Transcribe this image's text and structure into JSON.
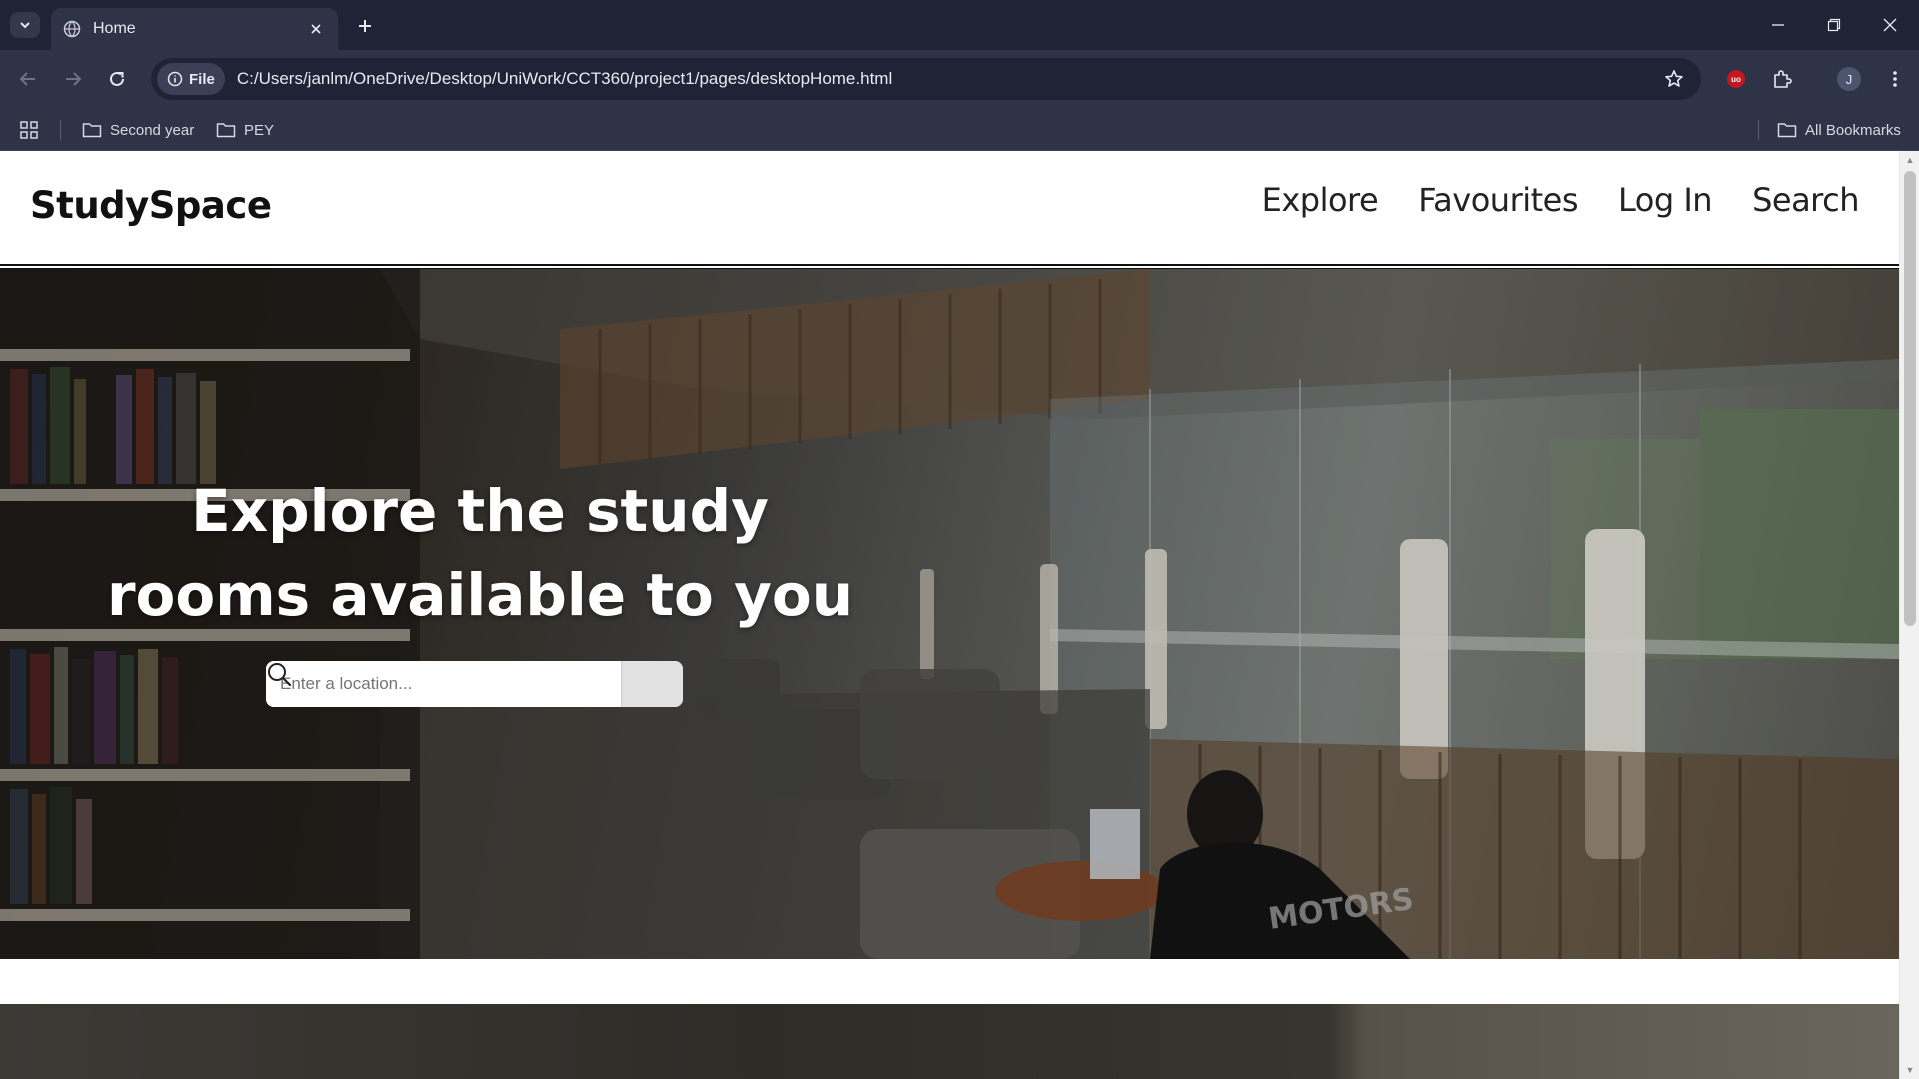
{
  "browser": {
    "tab_title": "Home",
    "url_chip": "File",
    "url": "C:/Users/janlm/OneDrive/Desktop/UniWork/CCT360/project1/pages/desktopHome.html",
    "profile_initial": "J",
    "ublock_label": "uo",
    "bookmarks": [
      {
        "label": "Second year"
      },
      {
        "label": "PEY"
      }
    ],
    "all_bookmarks": "All Bookmarks"
  },
  "site": {
    "logo": "StudySpace",
    "nav": [
      {
        "label": "Explore"
      },
      {
        "label": "Favourites"
      },
      {
        "label": "Log In"
      },
      {
        "label": "Search"
      }
    ],
    "hero": {
      "title": "Explore the study rooms available to you",
      "search_placeholder": "Enter a location..."
    }
  }
}
